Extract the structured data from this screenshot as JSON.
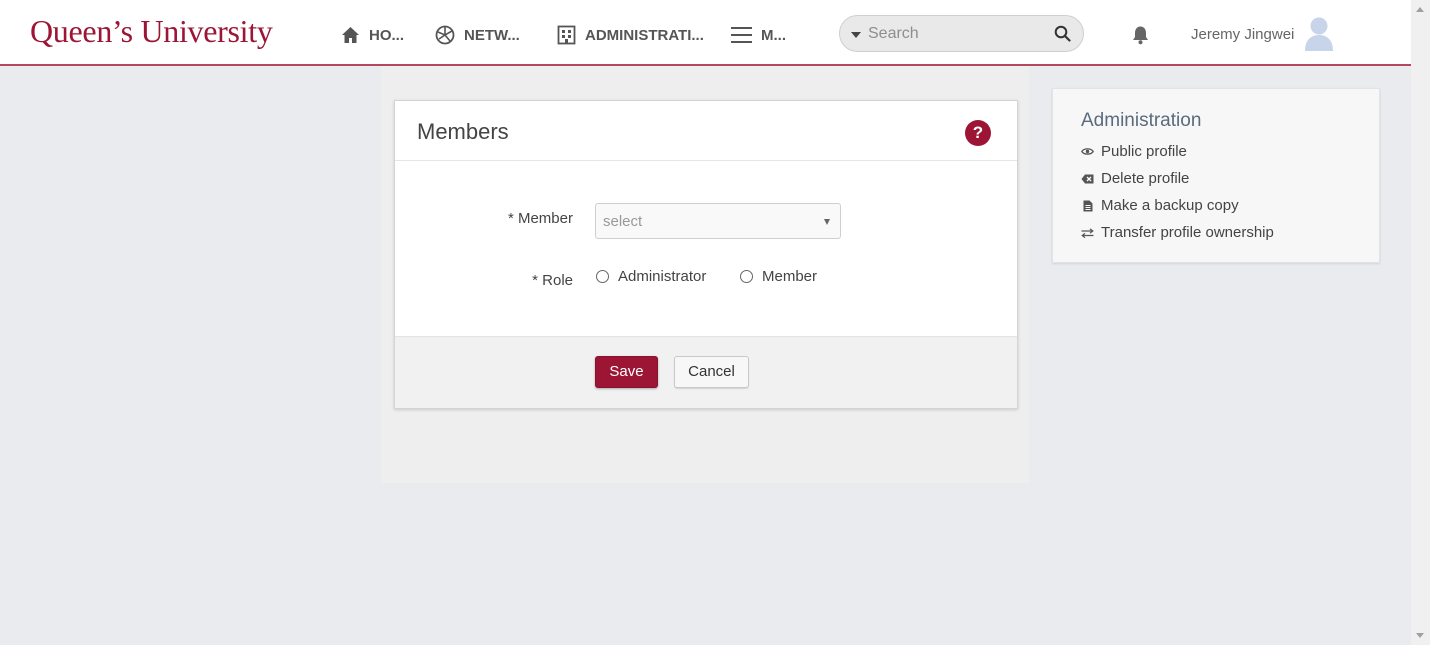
{
  "header": {
    "logo": "Queen’s University",
    "nav": [
      {
        "label": "HO...",
        "icon": "home-icon"
      },
      {
        "label": "NETW...",
        "icon": "network-globe-icon"
      },
      {
        "label": "ADMINISTRATI...",
        "icon": "building-icon"
      },
      {
        "label": "M...",
        "icon": "menu-icon"
      }
    ],
    "search": {
      "placeholder": "Search",
      "value": ""
    },
    "notifications_icon": "bell-icon",
    "user": {
      "name": "Jeremy Jingwei",
      "avatar_icon": "user-avatar-icon"
    }
  },
  "members_panel": {
    "title": "Members",
    "help_label": "?",
    "member_label": "* Member",
    "member_select": {
      "selected": "select"
    },
    "role_label": "* Role",
    "role_options": [
      "Administrator",
      "Member"
    ],
    "save_label": "Save",
    "cancel_label": "Cancel"
  },
  "admin_panel": {
    "title": "Administration",
    "links": [
      {
        "label": "Public profile",
        "icon": "eye-icon"
      },
      {
        "label": "Delete profile",
        "icon": "backspace-icon"
      },
      {
        "label": "Make a backup copy",
        "icon": "document-icon"
      },
      {
        "label": "Transfer profile ownership",
        "icon": "transfer-arrows-icon"
      }
    ]
  },
  "colors": {
    "brand": "#9d1535",
    "header_border": "#b5485e",
    "background": "#e9ebee"
  }
}
